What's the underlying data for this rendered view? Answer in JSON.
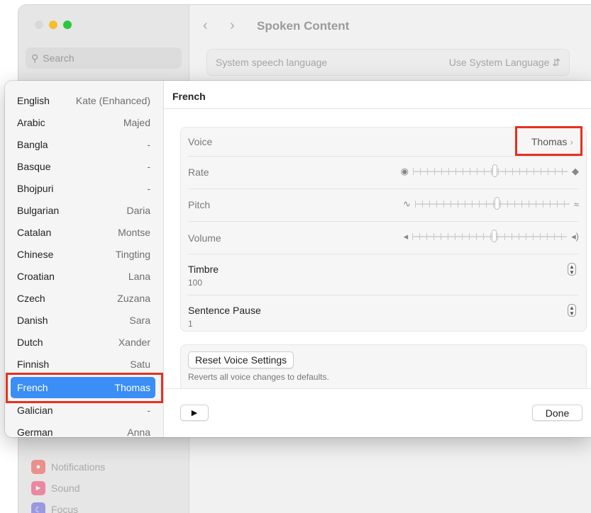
{
  "background_window": {
    "title": "Spoken Content",
    "search_placeholder": "Search",
    "row": {
      "label": "System speech language",
      "value": "Use System Language"
    },
    "sidebar_items": [
      {
        "label": "Notifications",
        "icon": "bell-icon",
        "color": "#f04a42"
      },
      {
        "label": "Sound",
        "icon": "speaker-icon",
        "color": "#ef3d69"
      },
      {
        "label": "Focus",
        "icon": "moon-icon",
        "color": "#5d5ad8"
      }
    ]
  },
  "languages": [
    {
      "language": "English",
      "voice": "Kate (Enhanced)"
    },
    {
      "language": "Arabic",
      "voice": "Majed"
    },
    {
      "language": "Bangla",
      "voice": "-"
    },
    {
      "language": "Basque",
      "voice": "-"
    },
    {
      "language": "Bhojpuri",
      "voice": "-"
    },
    {
      "language": "Bulgarian",
      "voice": "Daria"
    },
    {
      "language": "Catalan",
      "voice": "Montse"
    },
    {
      "language": "Chinese",
      "voice": "Tingting"
    },
    {
      "language": "Croatian",
      "voice": "Lana"
    },
    {
      "language": "Czech",
      "voice": "Zuzana"
    },
    {
      "language": "Danish",
      "voice": "Sara"
    },
    {
      "language": "Dutch",
      "voice": "Xander"
    },
    {
      "language": "Finnish",
      "voice": "Satu"
    },
    {
      "language": "French",
      "voice": "Thomas",
      "selected": true
    },
    {
      "language": "Galician",
      "voice": "-"
    },
    {
      "language": "German",
      "voice": "Anna"
    }
  ],
  "detail": {
    "title": "French",
    "voice_label": "Voice",
    "voice_value": "Thomas",
    "rate_label": "Rate",
    "rate_level": 0.5,
    "pitch_label": "Pitch",
    "pitch_level": 0.5,
    "volume_label": "Volume",
    "volume_level": 0.5,
    "timbre_label": "Timbre",
    "timbre_value": "100",
    "sentence_pause_label": "Sentence Pause",
    "sentence_pause_value": "1",
    "reset_label": "Reset Voice Settings",
    "reset_hint": "Reverts all voice changes to defaults.",
    "done_label": "Done"
  },
  "colors": {
    "accent": "#3a8ef6",
    "highlight": "#e8301e"
  }
}
